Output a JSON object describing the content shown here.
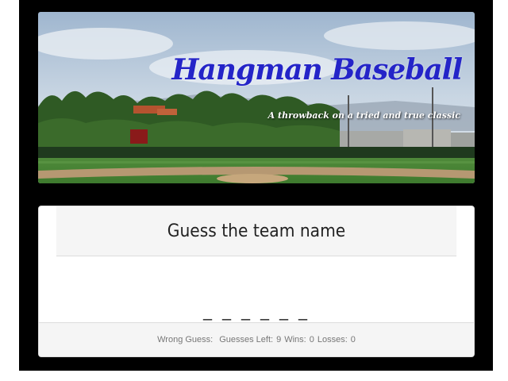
{
  "banner": {
    "title": "Hangman Baseball",
    "tagline": "A throwback on a tried and true classic",
    "image": "baseball-field-photo"
  },
  "game": {
    "heading": "Guess the team name",
    "masked_word": "_ _ _ _ _ _"
  },
  "stats": {
    "wrong_guess_label": "Wrong Guess:",
    "wrong_guess_value": "",
    "guesses_left_label": "Guesses Left:",
    "guesses_left_value": "9",
    "wins_label": "Wins:",
    "wins_value": "0",
    "losses_label": "Losses:",
    "losses_value": "0"
  },
  "colors": {
    "title": "#2424c8",
    "frame": "#000000",
    "panel_bg": "#f5f5f5"
  }
}
